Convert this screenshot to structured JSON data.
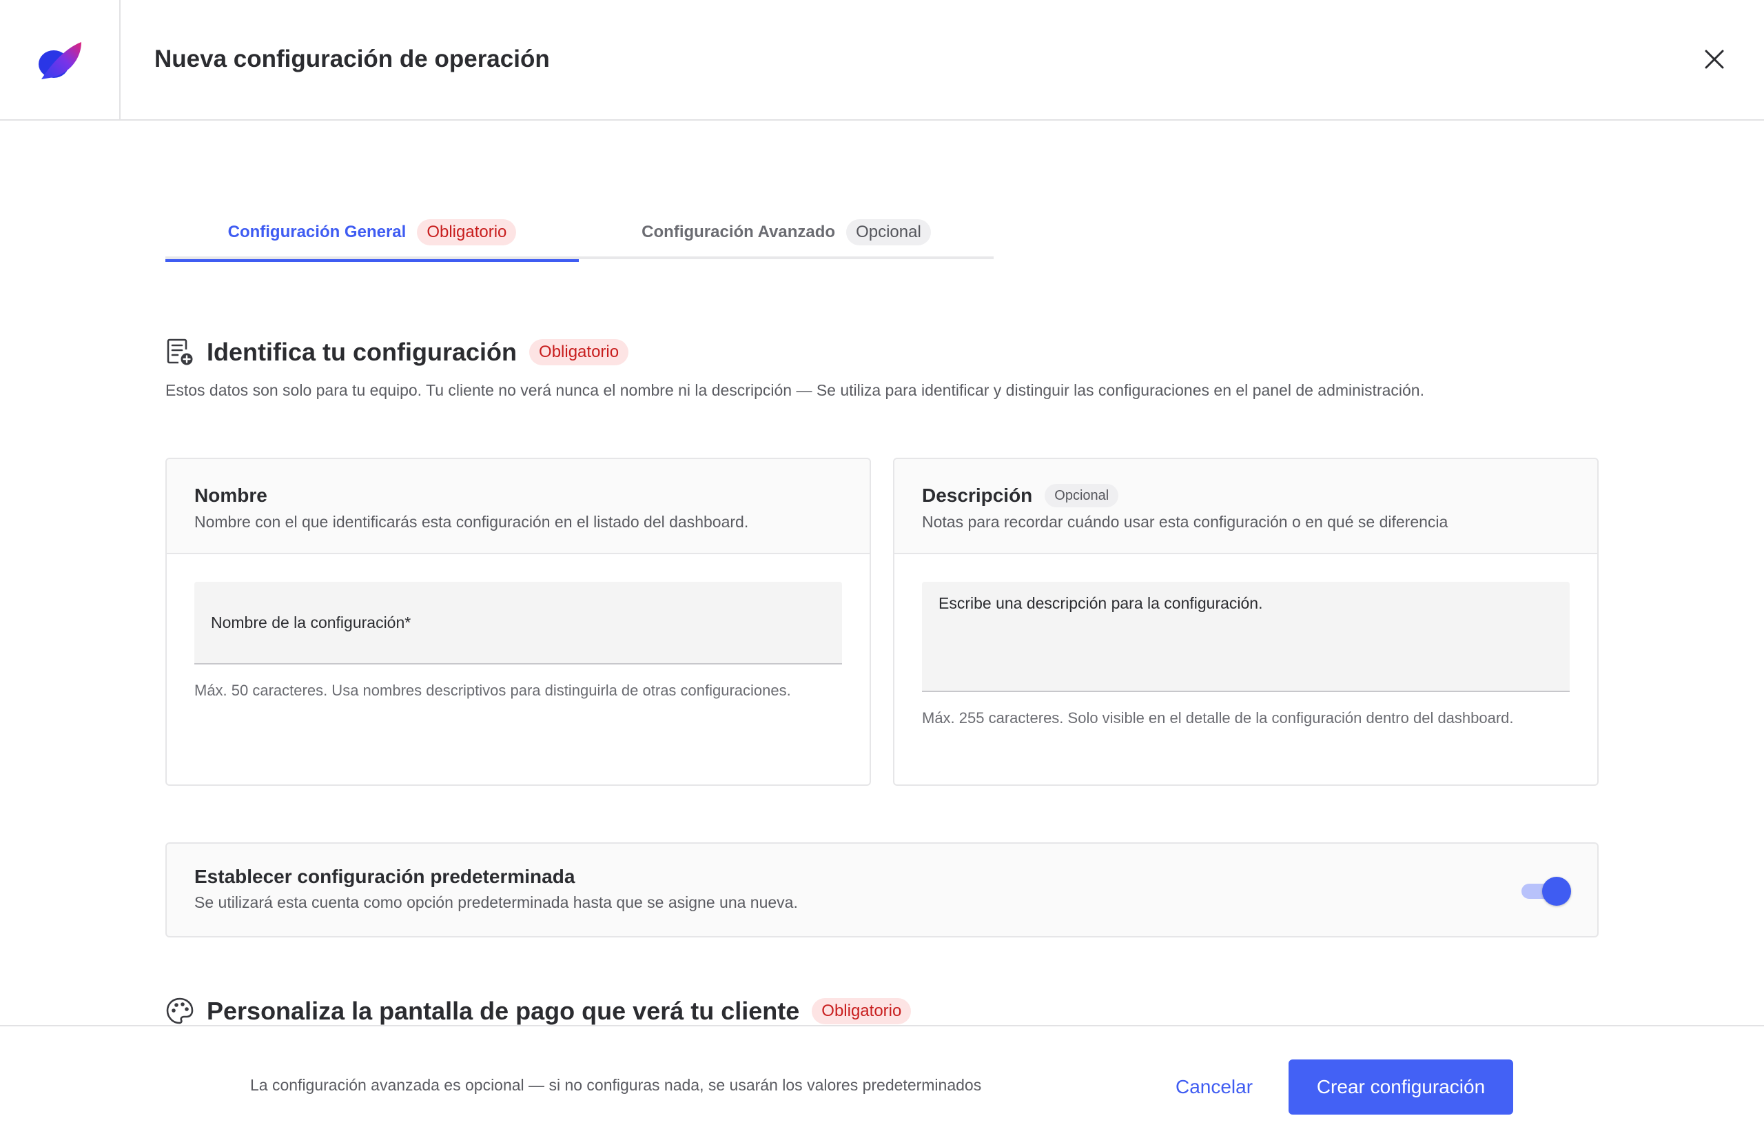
{
  "header": {
    "title": "Nueva configuración de operación",
    "logo_icon": "brand-logo-icon",
    "close_icon": "close-icon"
  },
  "tabs": [
    {
      "label": "Configuración General",
      "badge": "Obligatorio",
      "active": true
    },
    {
      "label": "Configuración Avanzado",
      "badge": "Opcional",
      "active": false
    }
  ],
  "section_identify": {
    "icon": "document-add-icon",
    "title": "Identifica tu configuración",
    "badge": "Obligatorio",
    "description": "Estos datos son solo para tu equipo. Tu cliente no verá nunca el nombre ni la descripción — Se utiliza para identificar y distinguir las configuraciones en el panel de administración."
  },
  "name_card": {
    "title": "Nombre",
    "subtitle": "Nombre con el que identificarás esta configuración en el listado del dashboard.",
    "field_label": "Nombre de la configuración*",
    "helper": "Máx. 50 caracteres. Usa nombres descriptivos para distinguirla de otras configuraciones."
  },
  "description_card": {
    "title": "Descripción",
    "badge": "Opcional",
    "subtitle": "Notas para recordar cuándo usar esta configuración o en qué se diferencia",
    "field_placeholder": "Escribe una descripción para la configuración.",
    "helper": "Máx. 255 caracteres. Solo visible en el detalle de la configuración dentro del dashboard."
  },
  "default_card": {
    "title": "Establecer configuración predeterminada",
    "subtitle": "Se utilizará esta cuenta como opción predeterminada hasta que se asigne una nueva.",
    "toggle_on": true
  },
  "section_checkout": {
    "icon": "palette-icon",
    "title": "Personaliza la pantalla de pago que verá tu cliente",
    "badge": "Obligatorio"
  },
  "footer": {
    "note": "La configuración avanzada es opcional — si no configuras nada, se usarán los valores predeterminados",
    "cancel_label": "Cancelar",
    "create_label": "Crear configuración"
  },
  "colors": {
    "accent": "#3f5cf2",
    "required_bg": "#fde4e4",
    "required_text": "#c81e1e",
    "border": "#e6e6e8"
  }
}
